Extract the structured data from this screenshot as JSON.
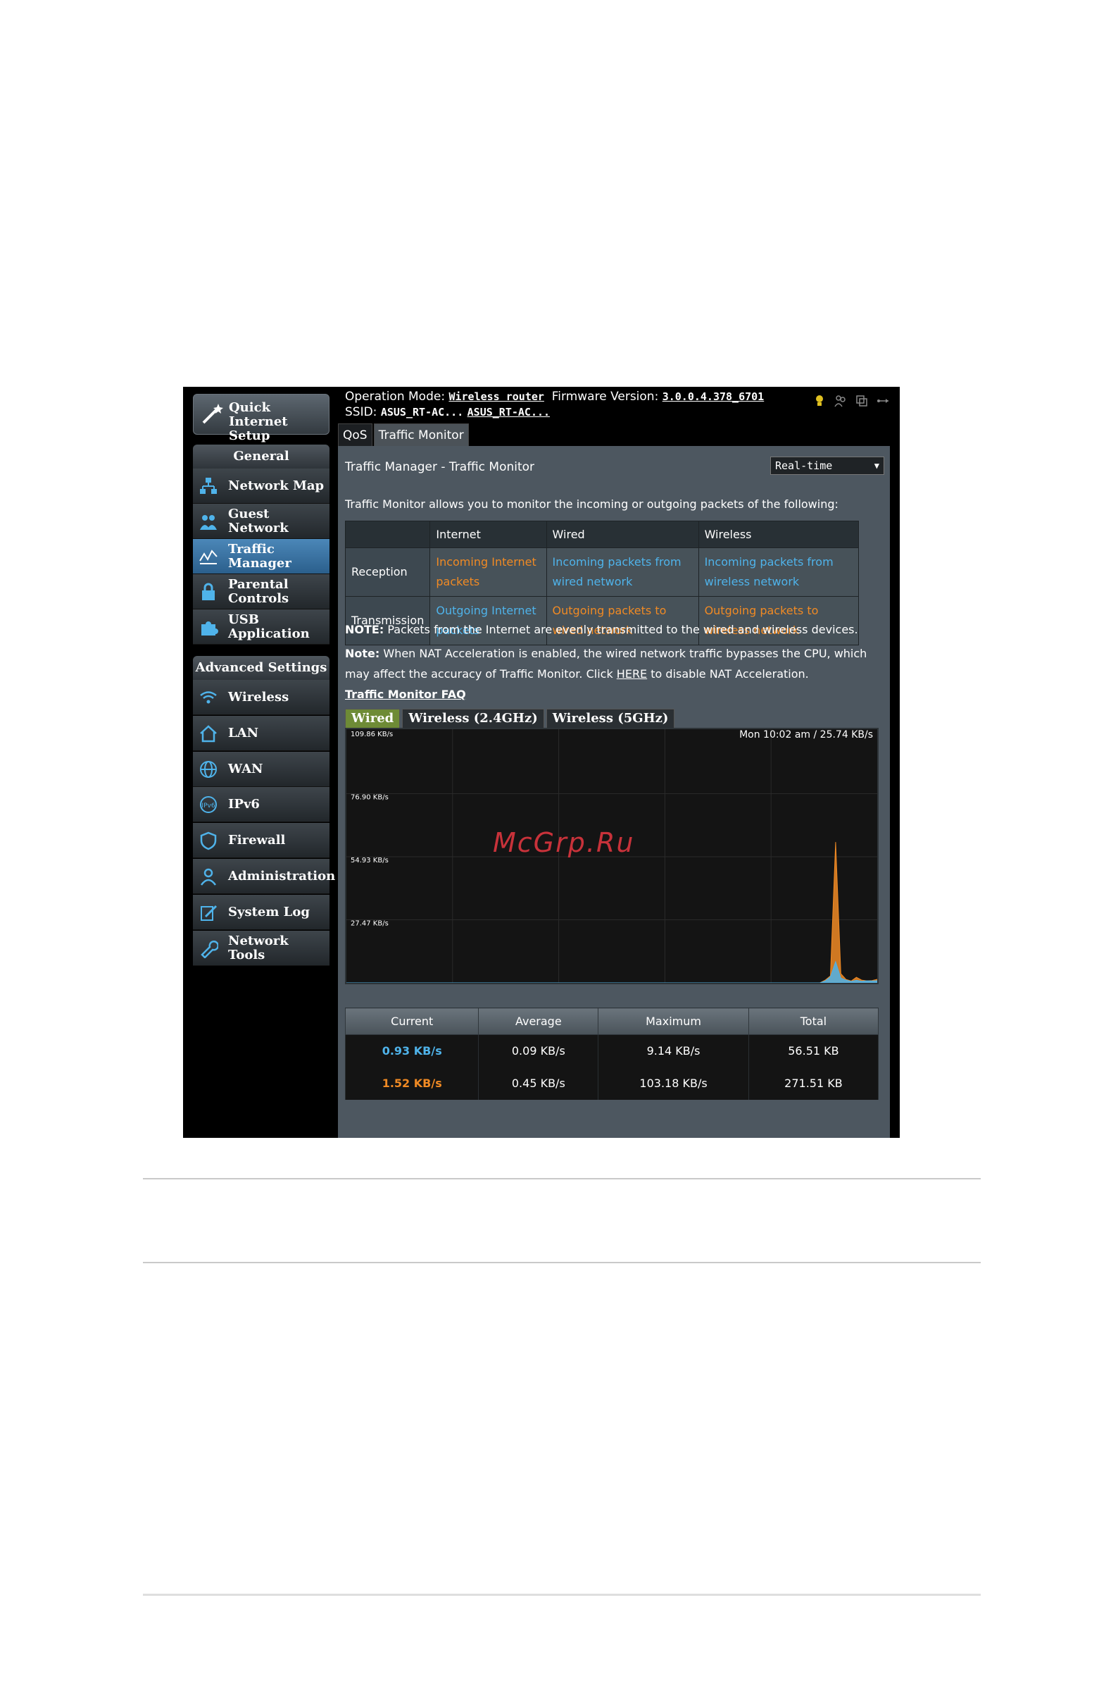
{
  "nav": {
    "quick_setup": "Quick Internet Setup",
    "general_header": "General",
    "general_items": [
      {
        "label1": "Network Map",
        "label2": "",
        "icon": "network-map-icon"
      },
      {
        "label1": "Guest",
        "label2": "Network",
        "icon": "guest-network-icon"
      },
      {
        "label1": "Traffic",
        "label2": "Manager",
        "icon": "traffic-manager-icon"
      },
      {
        "label1": "Parental",
        "label2": "Controls",
        "icon": "lock-icon"
      },
      {
        "label1": "USB",
        "label2": "Application",
        "icon": "puzzle-icon"
      }
    ],
    "advanced_header": "Advanced Settings",
    "advanced_items": [
      {
        "label1": "Wireless",
        "label2": "",
        "icon": "wifi-icon"
      },
      {
        "label1": "LAN",
        "label2": "",
        "icon": "home-icon"
      },
      {
        "label1": "WAN",
        "label2": "",
        "icon": "globe-icon"
      },
      {
        "label1": "IPv6",
        "label2": "",
        "icon": "ipv6-icon"
      },
      {
        "label1": "Firewall",
        "label2": "",
        "icon": "shield-icon"
      },
      {
        "label1": "Administration",
        "label2": "",
        "icon": "user-icon"
      },
      {
        "label1": "System Log",
        "label2": "",
        "icon": "edit-icon"
      },
      {
        "label1": "Network",
        "label2": "Tools",
        "icon": "wrench-icon"
      }
    ]
  },
  "topbar": {
    "op_mode_label": "Operation Mode:",
    "op_mode_value": "Wireless router",
    "firmware_label": "Firmware Version:",
    "firmware_value": "3.0.0.4.378_6701",
    "ssid_label": "SSID:",
    "ssid1": "ASUS_RT-AC...",
    "ssid2": "ASUS_RT-AC...",
    "tabs": [
      "QoS",
      "Traffic Monitor"
    ]
  },
  "main": {
    "title": "Traffic Manager - Traffic Monitor",
    "mode_select": "Real-time",
    "description": "Traffic Monitor allows you to monitor the incoming or outgoing packets of the following:",
    "table": {
      "headers": [
        "",
        "Internet",
        "Wired",
        "Wireless"
      ],
      "rows": [
        {
          "label": "Reception",
          "cells": [
            "Incoming Internet packets",
            "Incoming packets from wired network",
            "Incoming packets from wireless network"
          ]
        },
        {
          "label": "Transmission",
          "cells": [
            "Outgoing Internet packets",
            "Outgoing packets to wired network",
            "Outgoing packets to wireless network"
          ]
        }
      ]
    },
    "note1_label": "NOTE:",
    "note1_text": "Packets from the Internet are evenly transmitted to the wired and wireless devices.",
    "note2_label": "Note:",
    "note2_text": "When NAT Acceleration is enabled, the wired network traffic bypasses the CPU, which may affect the accuracy of Traffic Monitor. Click",
    "note2_link": "HERE",
    "note2_tail": "to disable NAT Acceleration.",
    "faq": "Traffic Monitor FAQ",
    "graph_tabs": [
      "Wired",
      "Wireless (2.4GHz)",
      "Wireless (5GHz)"
    ],
    "graph_status": "Mon 10:02 am / 25.74 KB/s",
    "stats": {
      "headers": [
        "Current",
        "Average",
        "Maximum",
        "Total"
      ],
      "rows": [
        [
          "0.93 KB/s",
          "0.09 KB/s",
          "9.14 KB/s",
          "56.51 KB"
        ],
        [
          "1.52 KB/s",
          "0.45 KB/s",
          "103.18 KB/s",
          "271.51 KB"
        ]
      ]
    }
  },
  "chart_data": {
    "type": "area",
    "y_ticks": [
      "109.86 KB/s",
      "76.90 KB/s",
      "54.93 KB/s",
      "27.47 KB/s"
    ],
    "ylim": [
      0,
      109.86
    ],
    "series": [
      {
        "name": "",
        "color": "#f08a24",
        "values": [
          0,
          0,
          0,
          0,
          0,
          0,
          0,
          0,
          0,
          0,
          0,
          0,
          0,
          0,
          0,
          0,
          0,
          0,
          0,
          0,
          0,
          0,
          0,
          0,
          0,
          0,
          0,
          0,
          0,
          0,
          0,
          0,
          0,
          0,
          0,
          0,
          0,
          0,
          0,
          0,
          0,
          0,
          0,
          0,
          0,
          0,
          0,
          0,
          0,
          0,
          0,
          0,
          0,
          0,
          0,
          0,
          0,
          0,
          0,
          0,
          0,
          0,
          0,
          0,
          0,
          0,
          0,
          0,
          0,
          0,
          0,
          0,
          0,
          0,
          0,
          0,
          0,
          0,
          0,
          0,
          0,
          0,
          0,
          0,
          0,
          0,
          0,
          0,
          0,
          0,
          0,
          0,
          1.2,
          3,
          61,
          4,
          1.5,
          0.8,
          2.4,
          1.2,
          0.9,
          1.0,
          1.52
        ]
      },
      {
        "name": "",
        "color": "#4fb3ea",
        "values": [
          0,
          0,
          0,
          0,
          0,
          0,
          0,
          0,
          0,
          0,
          0,
          0,
          0,
          0,
          0,
          0,
          0,
          0,
          0,
          0,
          0,
          0,
          0,
          0,
          0,
          0,
          0,
          0,
          0,
          0,
          0,
          0,
          0,
          0,
          0,
          0,
          0,
          0,
          0,
          0,
          0,
          0,
          0,
          0,
          0,
          0,
          0,
          0,
          0,
          0,
          0,
          0,
          0,
          0,
          0,
          0,
          0,
          0,
          0,
          0,
          0,
          0,
          0,
          0,
          0,
          0,
          0,
          0,
          0,
          0,
          0,
          0,
          0,
          0,
          0,
          0,
          0,
          0,
          0,
          0,
          0,
          0,
          0,
          0,
          0,
          0,
          0,
          0,
          0,
          0,
          0,
          0,
          0.8,
          2.6,
          9.14,
          2,
          1.2,
          0.6,
          1.1,
          0.7,
          0.9,
          0.8,
          0.93
        ]
      }
    ],
    "grid": true
  },
  "watermark": "McGrp.Ru"
}
